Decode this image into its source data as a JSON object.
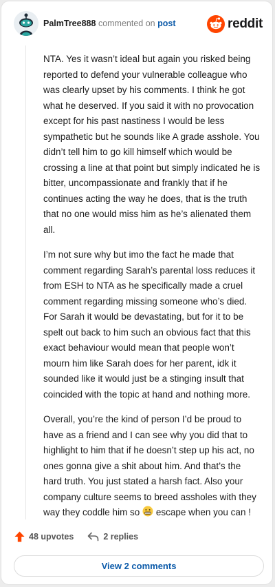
{
  "comment": {
    "username": "PalmTree888",
    "action_text": "commented on",
    "post_link": "post",
    "paragraphs": [
      "NTA. Yes it wasn’t ideal but again you risked being reported to defend your vulnerable colleague who was clearly upset by his comments. I think he got what he deserved. If you said it with no provocation except for his past nastiness I would be less sympathetic but he sounds like A grade asshole. You didn’t tell him to go kill himself which would be crossing a line at that point but simply indicated he is bitter, uncompassionate and frankly that if he continues acting the way he does, that is the truth that no one would miss him as he’s alienated them all.",
      "I’m not sure why but imo the fact he made that comment regarding Sarah’s parental loss reduces it from ESH to NTA as he specifically made a cruel comment regarding missing someone who’s died. For Sarah it would be devastating, but for it to be spelt out back to him such an obvious fact that this exact behaviour would mean that people won’t mourn him like Sarah does for her parent, idk it sounded like it would just be a stinging insult that coincided with the topic at hand and nothing more."
    ],
    "paragraph3_before_emoji": "Overall, you’re the kind of person I’d be proud to have as a friend and I can see why you did that to highlight to him that if he doesn’t step up his act, no ones gonna give a shit about him. And that’s the hard truth. You just stated a harsh fact. Also your company culture seems to breed assholes with they way they coddle him so",
    "paragraph3_after_emoji": "escape when you can !",
    "emoji_icon": "grimacing-face-icon"
  },
  "brand": {
    "wordmark": "reddit",
    "logo_icon": "reddit-logo-icon",
    "color": "#ff4500"
  },
  "actions": {
    "upvotes_label": "48 upvotes",
    "upvote_icon": "upvote-arrow-icon",
    "upvote_color": "#ff4500",
    "replies_label": "2 replies",
    "reply_icon": "reply-arrow-icon"
  },
  "view_comments_label": "View 2 comments",
  "colors": {
    "link": "#0b5aa9",
    "text": "#1c1c1c",
    "muted": "#7c7c7c"
  }
}
